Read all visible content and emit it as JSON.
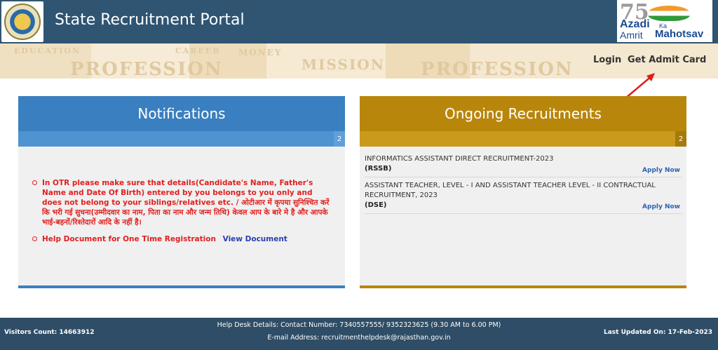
{
  "header": {
    "title": "State Recruitment Portal",
    "logo": "rajasthan-emblem",
    "badge": {
      "number": "75",
      "line1": "Azadi",
      "line2": "Ka",
      "line3": "Amrit",
      "line4": "Mahotsav"
    },
    "colors": {
      "header_bg": "#2f5572"
    }
  },
  "nav": {
    "login": "Login",
    "admit_card": "Get Admit Card"
  },
  "notifications": {
    "title": "Notifications",
    "count": "2",
    "items": [
      {
        "text": "In OTR please make sure that details(Candidate's Name, Father's Name and Date Of Birth) entered by you belongs to you only and does not belong to your siblings/relatives etc. / ओटीआर में कृपया सुनिश्चित करें कि भरी गई सुचना(उम्मीदवार का नाम, पिता का नाम और जन्म तिथि) केवल आप के बारे मे है और आपके भाई-बहनों/रिश्तेदारों आदि के नहीं है।"
      },
      {
        "text": "Help Document for One Time Registration",
        "link": "View Document"
      }
    ],
    "colors": {
      "header": "#3a7fbf",
      "sub": "#4f93d0"
    }
  },
  "recruitments": {
    "title": "Ongoing Recruitments",
    "count": "2",
    "items": [
      {
        "title": "INFORMATICS ASSISTANT DIRECT RECRUITMENT-2023",
        "org": "(RSSB)",
        "action": "Apply Now"
      },
      {
        "title": "ASSISTANT TEACHER, LEVEL - I AND ASSISTANT TEACHER LEVEL - II CONTRACTUAL RECRUITMENT, 2023",
        "org": "(DSE)",
        "action": "Apply Now"
      }
    ],
    "colors": {
      "header": "#b8860b",
      "sub": "#c99a1c"
    }
  },
  "footer": {
    "visitors": "Visitors Count: 14663912",
    "helpdesk": "Help Desk Details: Contact Number: 7340557555/ 9352323625 (9.30 AM to 6.00 PM)",
    "email": "E-mail Address: recruitmenthelpdesk@rajasthan.gov.in",
    "updated": "Last Updated On: 17-Feb-2023"
  },
  "banner": {
    "words": [
      "PROFESSION",
      "MONEY",
      "MISSION",
      "PROFESSION",
      "EDUCATION",
      "CAREER"
    ]
  }
}
